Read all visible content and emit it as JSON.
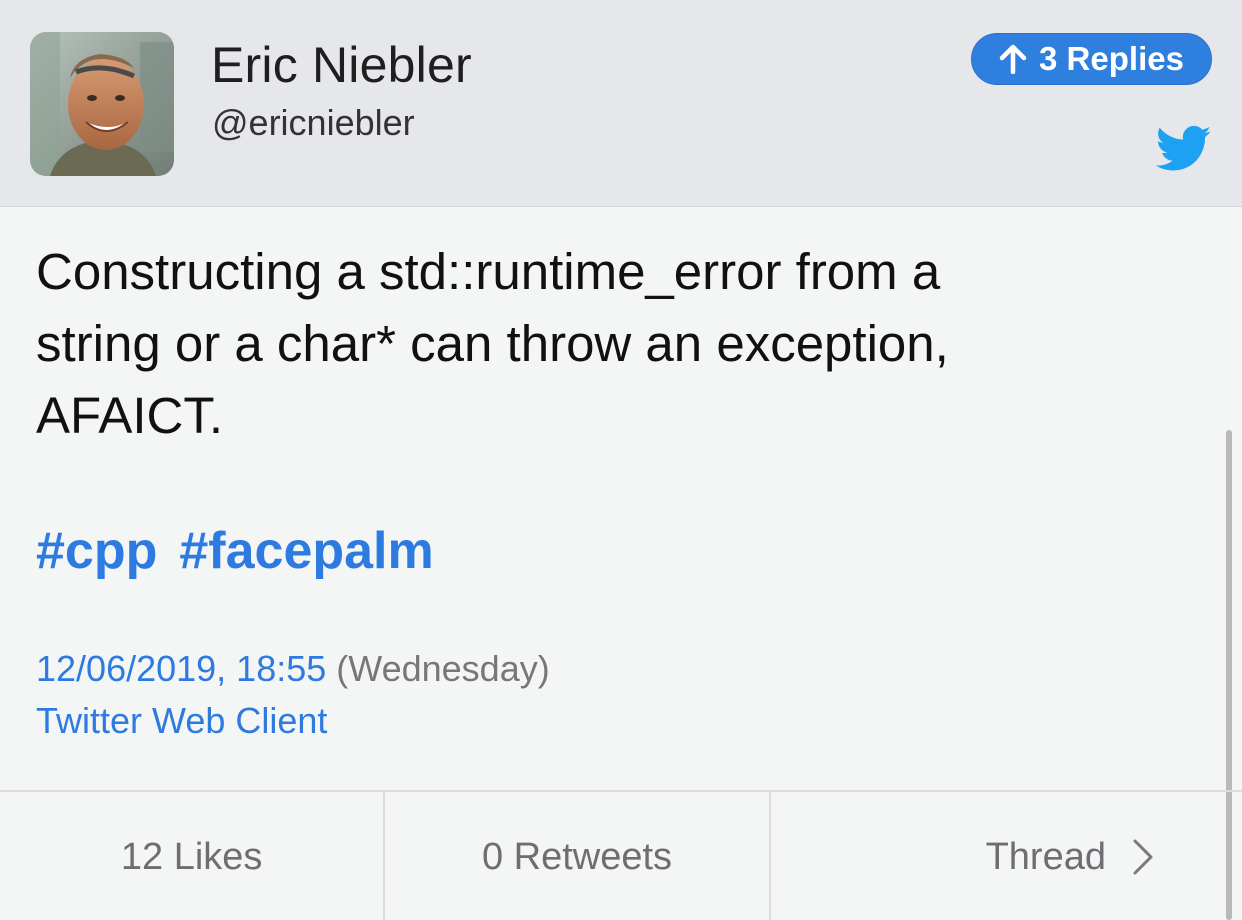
{
  "header": {
    "display_name": "Eric Niebler",
    "handle": "@ericniebler",
    "replies_label": "3 Replies",
    "accent_color": "#2f7fdf"
  },
  "tweet": {
    "text": "Constructing a std::runtime_error from a\nstring or a char* can throw an exception,\nAFAICT.",
    "hashtags": [
      "#cpp",
      "#facepalm"
    ],
    "date": "12/06/2019, 18:55",
    "weekday": "(Wednesday)",
    "client": "Twitter Web Client",
    "link_color": "#2d7be0"
  },
  "footer": {
    "likes": "12 Likes",
    "retweets": "0 Retweets",
    "thread": "Thread"
  },
  "icons": {
    "replies": "arrow-up-icon",
    "brand": "twitter-bird-icon",
    "thread": "chevron-right-icon"
  }
}
